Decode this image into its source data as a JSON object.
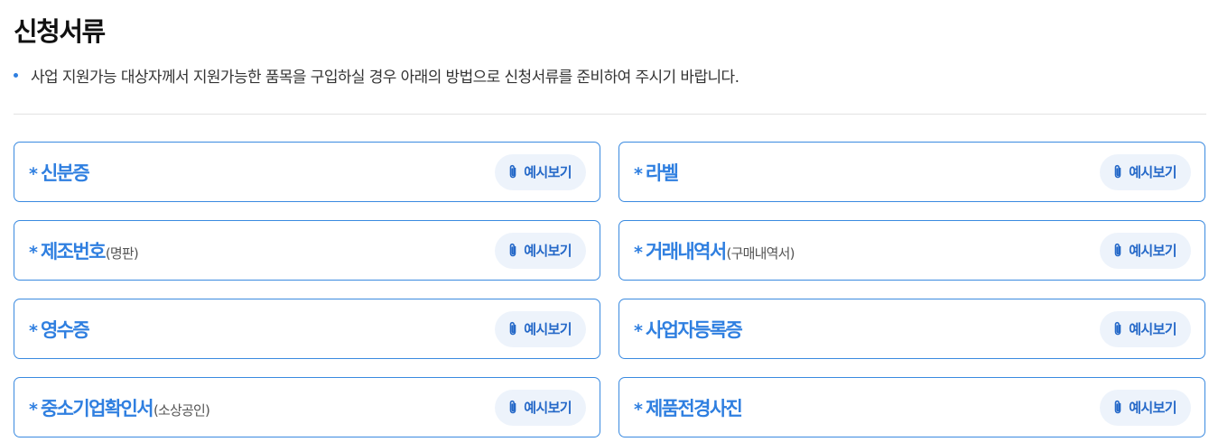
{
  "page": {
    "title": "신청서류",
    "notice": "사업 지원가능 대상자께서 지원가능한 품목을 구입하실 경우 아래의 방법으로 신청서류를 준비하여 주시기 바랍니다."
  },
  "colors": {
    "accent": "#2f7fe0",
    "card_border": "#3a8ae0",
    "button_bg": "#edf3fb",
    "button_text": "#2468c8",
    "divider": "#e2e2e2"
  },
  "documents": [
    {
      "star": "*",
      "label": "신분증",
      "sub": "",
      "button_label": "예시보기",
      "icon": "paperclip-icon"
    },
    {
      "star": "*",
      "label": "라벨",
      "sub": "",
      "button_label": "예시보기",
      "icon": "paperclip-icon"
    },
    {
      "star": "*",
      "label": "제조번호",
      "sub": "(명판)",
      "button_label": "예시보기",
      "icon": "paperclip-icon"
    },
    {
      "star": "*",
      "label": "거래내역서",
      "sub": "(구매내역서)",
      "button_label": "예시보기",
      "icon": "paperclip-icon"
    },
    {
      "star": "*",
      "label": "영수증",
      "sub": "",
      "button_label": "예시보기",
      "icon": "paperclip-icon"
    },
    {
      "star": "*",
      "label": "사업자등록증",
      "sub": "",
      "button_label": "예시보기",
      "icon": "paperclip-icon"
    },
    {
      "star": "*",
      "label": "중소기업확인서",
      "sub": "(소상공인)",
      "button_label": "예시보기",
      "icon": "paperclip-icon"
    },
    {
      "star": "*",
      "label": "제품전경사진",
      "sub": "",
      "button_label": "예시보기",
      "icon": "paperclip-icon"
    }
  ]
}
